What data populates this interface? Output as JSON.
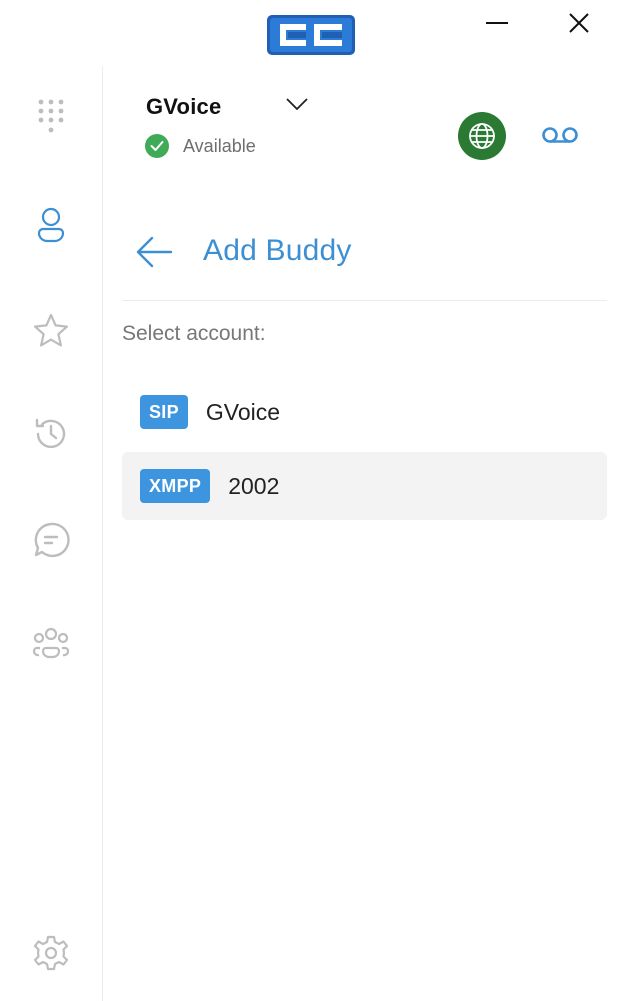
{
  "window": {
    "logo": "cc-logo"
  },
  "sidebar": {
    "items": [
      {
        "name": "dialpad",
        "icon": "dialpad-icon"
      },
      {
        "name": "contacts",
        "icon": "person-icon",
        "active": true
      },
      {
        "name": "favorites",
        "icon": "star-icon"
      },
      {
        "name": "history",
        "icon": "history-icon"
      },
      {
        "name": "chat",
        "icon": "chat-icon"
      },
      {
        "name": "groups",
        "icon": "group-icon"
      },
      {
        "name": "settings",
        "icon": "gear-icon"
      }
    ]
  },
  "header": {
    "account_name": "GVoice",
    "status": "Available",
    "globe_color": "#2b7a33",
    "status_color": "#3fab58"
  },
  "page": {
    "title": "Add Buddy",
    "select_label": "Select account:"
  },
  "accounts": [
    {
      "badge": "SIP",
      "label": "GVoice"
    },
    {
      "badge": "XMPP",
      "label": "2002"
    }
  ],
  "colors": {
    "accent": "#3d8fd4",
    "badge": "#3d95e0"
  }
}
